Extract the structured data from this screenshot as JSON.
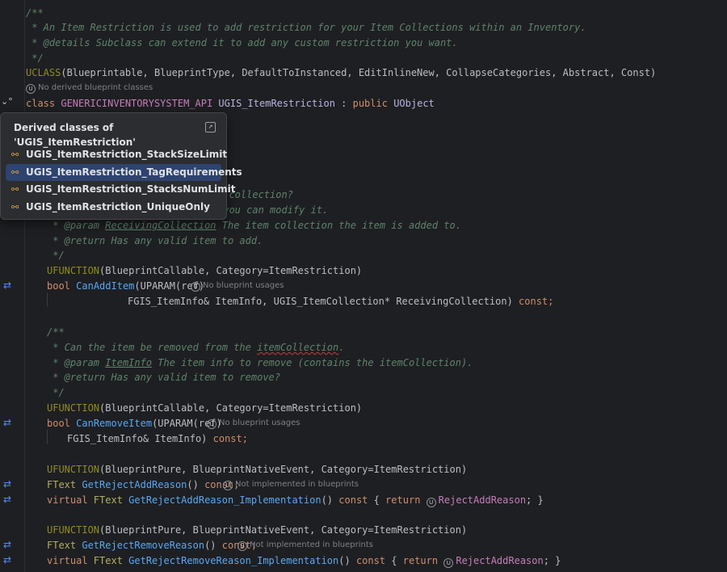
{
  "editor": {
    "lines": {
      "l1": "/**",
      "l2": " * An Item Restriction is used to add restriction for your Item Collections within an Inventory.",
      "l3_tag": " * @details",
      "l3_text": " Subclass can extend it to add any custom restriction you want.",
      "l4": " */",
      "uclass_kw": "UCLASS",
      "uclass_args": "(Blueprintable, BlueprintType, DefaultToInstanced, EditInlineNew, CollapseCategories, Abstract, Const)",
      "hint_uclass": "No derived blueprint classes",
      "class_kw": "class",
      "class_api": " GENERICINVENTORYSYSTEM_API ",
      "class_name": "UGIS_ItemRestriction",
      "class_rest": " : ",
      "class_public": "public",
      "class_base": " UObject",
      "c1_frag": "m collection?",
      "c2_frag": " you can modify it.",
      "c3_tag": " * @param",
      "c3_param": "ReceivingCollection",
      "c3_text": " The item collection the item is added to.",
      "c4_tag": " * @return",
      "c4_text": " Has any valid item to add.",
      "c5": " */",
      "uf1": "UFUNCTION",
      "uf1_args": "(BlueprintCallable, Category=ItemRestriction)",
      "can_add_bool": "bool",
      "can_add_name": "CanAddItem",
      "can_add_param": "(UPARAM(ref)",
      "hint_can_add": "No blueprint usages",
      "can_add_args": "FGIS_ItemInfo& ItemInfo, UGIS_ItemCollection* ReceivingCollection)",
      "can_add_const": " const;",
      "d1": "/**",
      "d2_a": " * Can the item be removed from the ",
      "d2_b": "itemCollection",
      "d2_c": ".",
      "d3_tag": " * @param",
      "d3_param": "ItemInfo",
      "d3_text": " The item info to remove (contains the itemCollection).",
      "d4_tag": " * @return",
      "d4_text": " Has any valid item to remove?",
      "d5": " */",
      "uf2": "UFUNCTION",
      "uf2_args": "(BlueprintCallable, Category=ItemRestriction)",
      "can_remove_bool": "bool",
      "can_remove_name": "CanRemoveItem",
      "can_remove_param": "(UPARAM(ref)",
      "hint_can_remove": "No blueprint usages",
      "can_remove_args": "FGIS_ItemInfo& ItemInfo)",
      "can_remove_const": " const;",
      "uf3": "UFUNCTION",
      "uf3_args": "(BlueprintPure, BlueprintNativeEvent, Category=ItemRestriction)",
      "gar_type": "FText",
      "gar_name": "GetRejectAddReason",
      "gar_rest": "()",
      "gar_const": " const;",
      "hint_gar": "Not implemented in blueprints",
      "garimpl_virtual": "virtual",
      "garimpl_type": " FText ",
      "garimpl_name": "GetRejectAddReason_Implementation",
      "garimpl_rest": "() ",
      "garimpl_const": "const",
      "garimpl_brace": " { ",
      "garimpl_return": "return",
      "garimpl_value": "RejectAddReason",
      "garimpl_end": "; }",
      "uf4": "UFUNCTION",
      "uf4_args": "(BlueprintPure, BlueprintNativeEvent, Category=ItemRestriction)",
      "grr_type": "FText",
      "grr_name": "GetRejectRemoveReason",
      "grr_rest": "()",
      "grr_const": " const;",
      "hint_grr": "Not implemented in blueprints",
      "grrimpl_virtual": "virtual",
      "grrimpl_type": " FText ",
      "grrimpl_name": "GetRejectRemoveReason_Implementation",
      "grrimpl_rest": "() ",
      "grrimpl_const": "const",
      "grrimpl_brace": " { ",
      "grrimpl_return": "return",
      "grrimpl_value": "RejectAddReason",
      "grrimpl_end": "; }"
    }
  },
  "popup": {
    "title": "Derived classes of 'UGIS_ItemRestriction'",
    "items": [
      {
        "label": "UGIS_ItemRestriction_StackSizeLimit"
      },
      {
        "label": "UGIS_ItemRestriction_TagRequirements"
      },
      {
        "label": "UGIS_ItemRestriction_StacksNumLimit"
      },
      {
        "label": "UGIS_ItemRestriction_UniqueOnly"
      }
    ]
  },
  "icons": {
    "gutter": "override-icon",
    "popup_item": "derived-class-icon",
    "unreal": "unreal-icon"
  },
  "colors": {
    "background": "#1e1f22",
    "popup_bg": "#2b2d30",
    "selection": "#2e436e",
    "comment": "#5f826b",
    "keyword": "#cf8e6d",
    "function": "#56a8f5"
  }
}
